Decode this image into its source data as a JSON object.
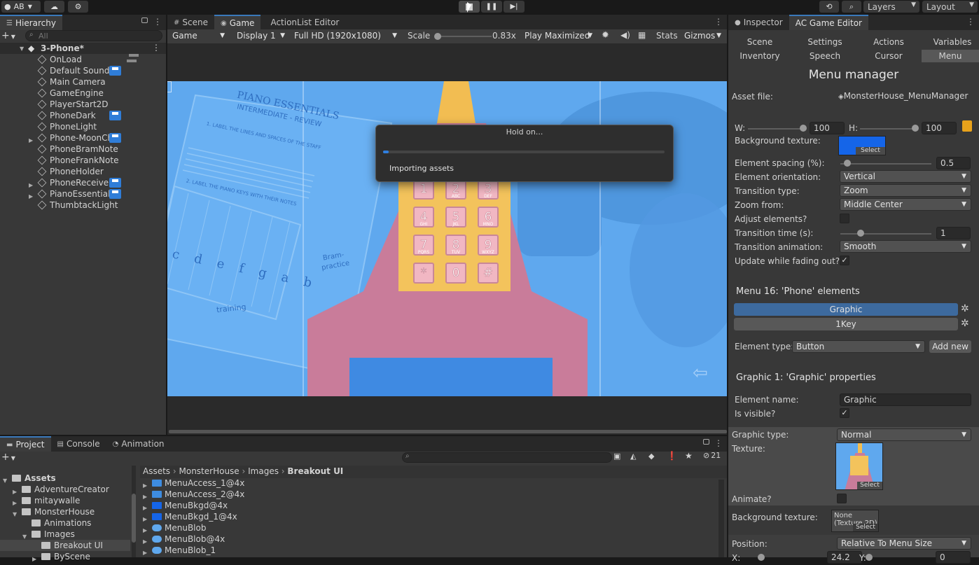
{
  "toolbar": {
    "account": "AB",
    "layers": "Layers",
    "layout": "Layout"
  },
  "hierarchy": {
    "tab": "Hierarchy",
    "search_placeholder": "All",
    "scene": "3-Phone*",
    "items": [
      "OnLoad",
      "Default Sound",
      "Main Camera",
      "GameEngine",
      "PlayerStart2D",
      "PhoneDark",
      "PhoneLight",
      "Phone-MoonCh",
      "PhoneBramNote",
      "PhoneFrankNote",
      "PhoneHolder",
      "PhoneReceiver",
      "PianoEssentials",
      "ThumbtackLight"
    ]
  },
  "center": {
    "tabs": [
      "Scene",
      "Game",
      "ActionList Editor"
    ],
    "game_toolbar": {
      "mode": "Game",
      "display": "Display 1",
      "resolution": "Full HD (1920x1080)",
      "scale_label": "Scale",
      "scale_value": "0.83x",
      "play_mode": "Play Maximized",
      "stats": "Stats",
      "gizmos": "Gizmos"
    },
    "sheet": {
      "title": "PIANO ESSENTIALS",
      "subtitle": "INTERMEDIATE - REVIEW",
      "step1": "1. LABEL THE LINES AND SPACES OF THE STAFF",
      "step2": "2. LABEL THE PIANO KEYS WITH THEIR NOTES",
      "notes": "c d e f g a b",
      "scribble1": "Bram-",
      "scribble2": "practice",
      "scribble3": "training"
    },
    "keypad": [
      "1",
      "2",
      "3",
      "4",
      "5",
      "6",
      "7",
      "8",
      "9",
      "*",
      "0",
      "#"
    ],
    "keypad_sub": [
      "",
      "ABC",
      "DEF",
      "GHI",
      "JKL",
      "MNO",
      "PQRS",
      "TUV",
      "WXYZ",
      "",
      "",
      ""
    ],
    "dialog": {
      "title": "Hold on...",
      "message": "Importing assets",
      "progress": 0.02
    }
  },
  "inspector": {
    "tabs": [
      "Inspector",
      "AC Game Editor"
    ],
    "nav": [
      "Scene",
      "Settings",
      "Actions",
      "Variables",
      "Inventory",
      "Speech",
      "Cursor",
      "Menu"
    ],
    "title": "Menu manager",
    "asset_file_label": "Asset file:",
    "asset_file": "MonsterHouse_MenuManager",
    "w_label": "W:",
    "w": "100",
    "h_label": "H:",
    "h": "100",
    "bg_texture_label": "Background texture:",
    "select": "Select",
    "spacing_label": "Element spacing (%):",
    "spacing": "0.5",
    "orientation_label": "Element orientation:",
    "orientation": "Vertical",
    "transition_label": "Transition type:",
    "transition": "Zoom",
    "zoom_from_label": "Zoom from:",
    "zoom_from": "Middle Center",
    "adjust_label": "Adjust elements?",
    "ttime_label": "Transition time (s):",
    "ttime": "1",
    "tanim_label": "Transition animation:",
    "tanim": "Smooth",
    "update_label": "Update while fading out?",
    "menu_title": "Menu 16: 'Phone' elements",
    "elements": [
      "Graphic",
      "1Key"
    ],
    "etype_label": "Element type:",
    "etype": "Button",
    "add_new": "Add new",
    "props_title": "Graphic 1: 'Graphic' properties",
    "ename_label": "Element name:",
    "ename": "Graphic",
    "visible_label": "Is visible?",
    "gtype_label": "Graphic type:",
    "gtype": "Normal",
    "texture_label": "Texture:",
    "animate_label": "Animate?",
    "bgt2_label": "Background texture:",
    "bgt2": "None (Texture 2D)",
    "position_label": "Position:",
    "position": "Relative To Menu Size",
    "x_label": "X:",
    "x_value": "24.2",
    "y_label": "Y:",
    "y_value": "0"
  },
  "bottom": {
    "tabs": [
      "Project",
      "Console",
      "Animation"
    ],
    "count": "21",
    "tree": [
      "Assets",
      "AdventureCreator",
      "mitaywalle",
      "MonsterHouse",
      "Animations",
      "Images",
      "Breakout UI",
      "ByScene"
    ],
    "breadcrumb": [
      "Assets",
      "MonsterHouse",
      "Images",
      "Breakout UI"
    ],
    "files": [
      "MenuAccess_1@4x",
      "MenuAccess_2@4x",
      "MenuBkgd@4x",
      "MenuBkgd_1@4x",
      "MenuBlob",
      "MenuBlob@4x",
      "MenuBlob_1"
    ]
  },
  "colors": {
    "accent": "#3a79bb",
    "bg_texture": "#1565e8",
    "game_blue": "#5fa8ee"
  }
}
